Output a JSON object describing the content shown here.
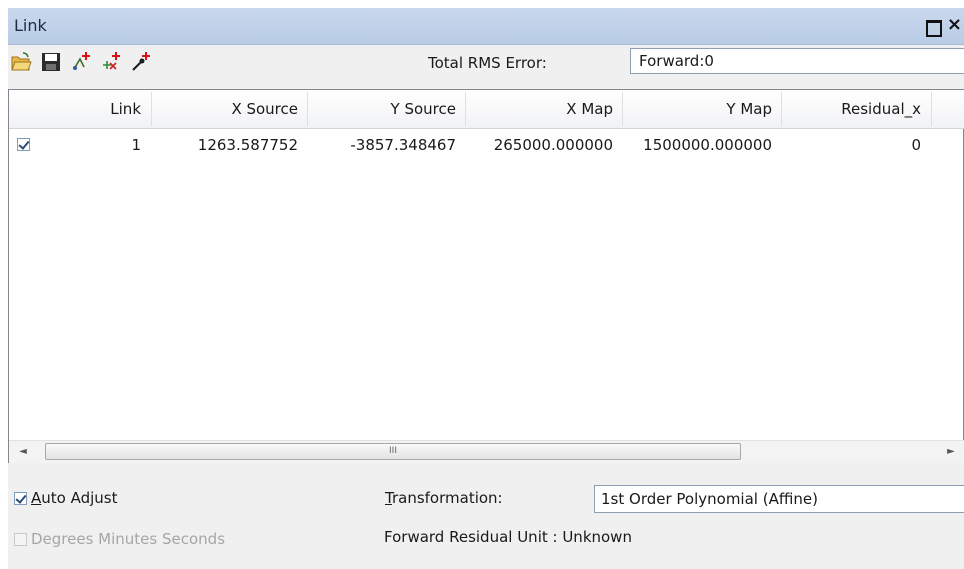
{
  "window": {
    "title": "Link",
    "maximize_glyph": "□",
    "close_glyph": "×"
  },
  "toolbar": {
    "icons": [
      "open-folder-icon",
      "save-icon",
      "add-link-icon",
      "delete-link-icon",
      "auto-link-icon"
    ],
    "rms_label": "Total RMS Error:",
    "rms_value": "Forward:0"
  },
  "table": {
    "headers": {
      "link": "Link",
      "x_source": "X Source",
      "y_source": "Y Source",
      "x_map": "X Map",
      "y_map": "Y Map",
      "residual_x": "Residual_x"
    },
    "rows": [
      {
        "checked": true,
        "link": "1",
        "x_source": "1263.587752",
        "y_source": "-3857.348467",
        "x_map": "265000.000000",
        "y_map": "1500000.000000",
        "residual_x": "0"
      }
    ],
    "scroll_left": "◄",
    "scroll_right": "►",
    "scroll_grip": "III"
  },
  "options": {
    "auto_adjust_checked": true,
    "auto_adjust_label_pre": "",
    "auto_adjust_label_accel": "A",
    "auto_adjust_label_post": "uto Adjust",
    "dms_checked": false,
    "dms_label": "Degrees Minutes Seconds",
    "transformation_label_accel": "T",
    "transformation_label_post": "ransformation:",
    "transformation_value": "1st Order Polynomial (Affine)",
    "residual_unit": "Forward Residual Unit : Unknown"
  },
  "colors": {
    "titlebar": "#c0d3ea",
    "panel": "#f0f0f0",
    "accent_border": "#8f9fb3"
  }
}
